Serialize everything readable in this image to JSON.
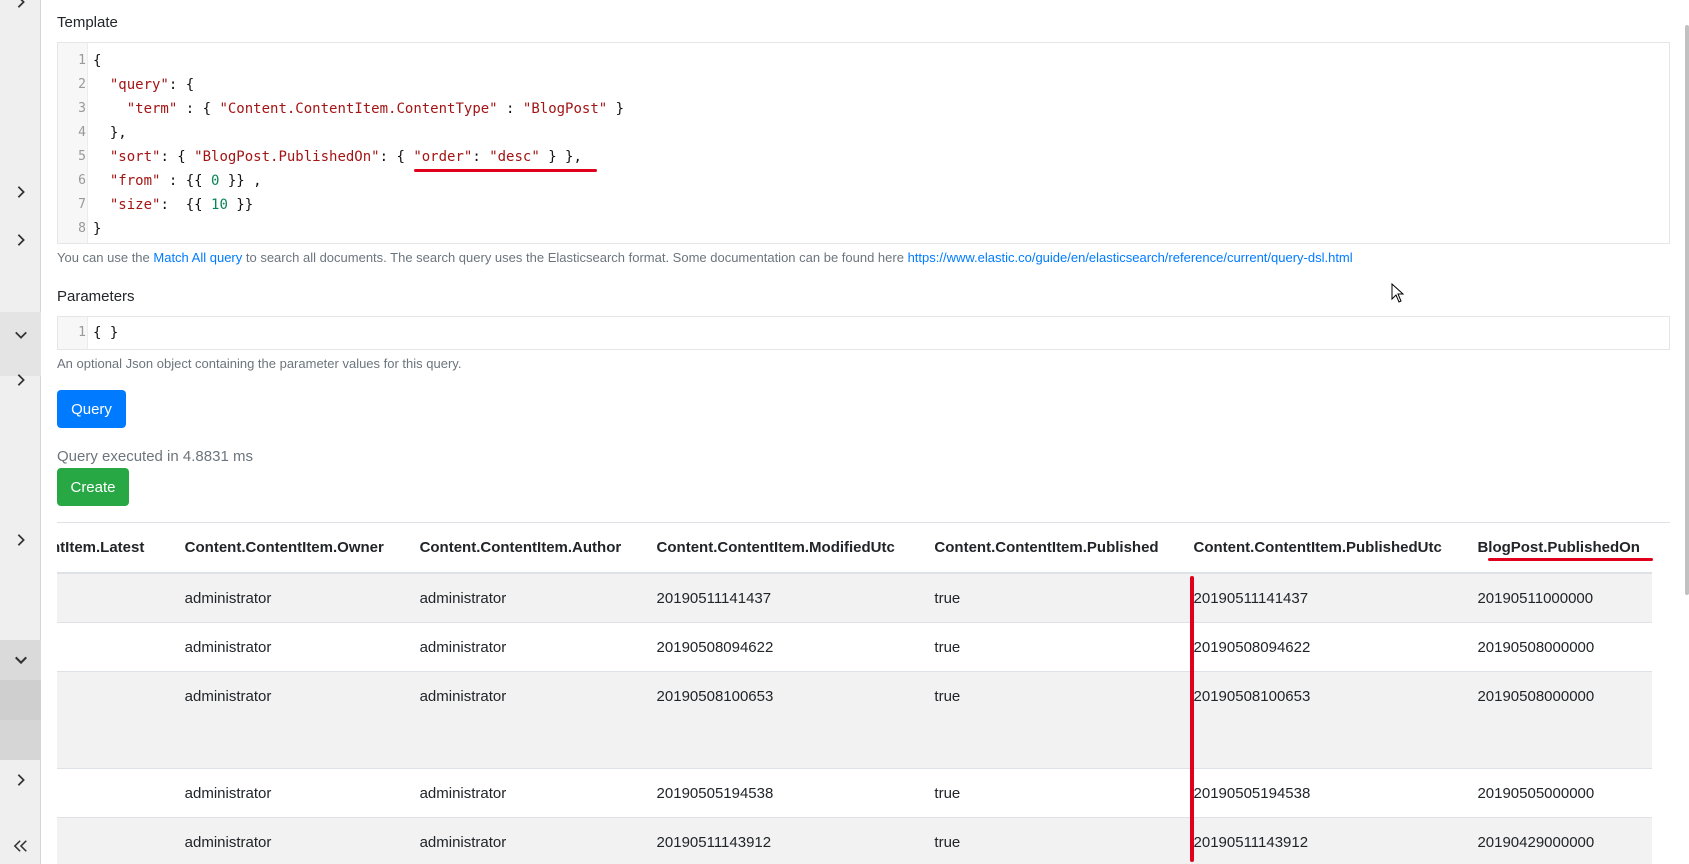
{
  "template": {
    "label": "Template",
    "line_numbers": [
      "1",
      "2",
      "3",
      "4",
      "5",
      "6",
      "7",
      "8"
    ],
    "help_prefix": "You can use the ",
    "help_link1": "Match All query",
    "help_middle": " to search all documents. The search query uses the Elasticsearch format. Some documentation can be found here ",
    "help_link2": "https://www.elastic.co/guide/en/elasticsearch/reference/current/query-dsl.html"
  },
  "parameters": {
    "label": "Parameters",
    "line_number": "1",
    "code": "{ }",
    "help": "An optional Json object containing the parameter values for this query."
  },
  "buttons": {
    "query": "Query",
    "create": "Create"
  },
  "status": {
    "message": "Query executed in 4.8831 ms"
  },
  "table": {
    "headers": [
      "ntItem.Latest",
      "Content.ContentItem.Owner",
      "Content.ContentItem.Author",
      "Content.ContentItem.ModifiedUtc",
      "Content.ContentItem.Published",
      "Content.ContentItem.PublishedUtc",
      "BlogPost.PublishedOn"
    ],
    "rows": [
      [
        "",
        "administrator",
        "administrator",
        "20190511141437",
        "true",
        "20190511141437",
        "20190511000000"
      ],
      [
        "",
        "administrator",
        "administrator",
        "20190508094622",
        "true",
        "20190508094622",
        "20190508000000"
      ],
      [
        "",
        "administrator",
        "administrator",
        "20190508100653",
        "true",
        "20190508100653",
        "20190508000000"
      ],
      [
        "",
        "administrator",
        "administrator",
        "20190505194538",
        "true",
        "20190505194538",
        "20190505000000"
      ],
      [
        "",
        "administrator",
        "administrator",
        "20190511143912",
        "true",
        "20190511143912",
        "20190429000000"
      ]
    ]
  },
  "icons": {
    "rail_expand": "chevron-right-icon",
    "rail_collapse": "chevron-down-icon",
    "rail_collapse_all": "double-chevron-left-icon"
  },
  "colors": {
    "primary": "#007bff",
    "success": "#28a745",
    "annotation": "#e0001b"
  }
}
